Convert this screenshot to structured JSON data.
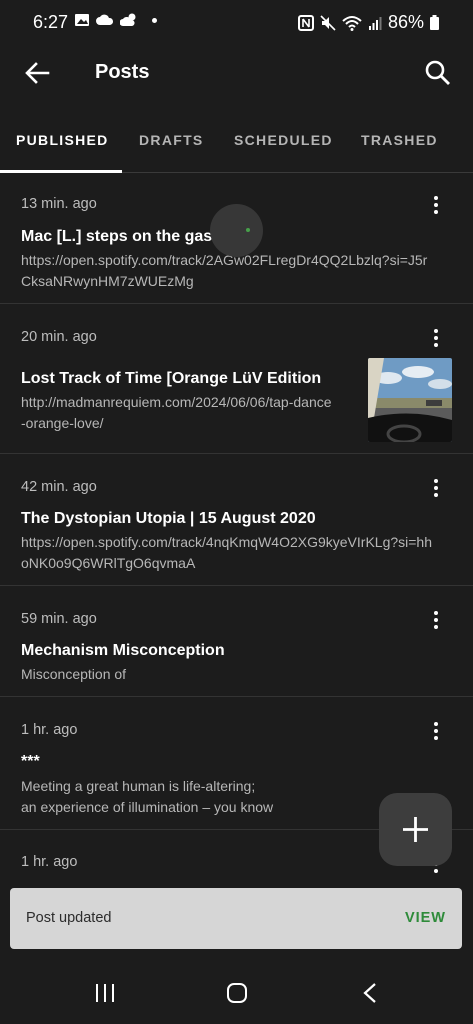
{
  "status_bar": {
    "time": "6:27",
    "battery": "86%"
  },
  "app_bar": {
    "title": "Posts"
  },
  "tabs": [
    {
      "label": "PUBLISHED"
    },
    {
      "label": "DRAFTS"
    },
    {
      "label": "SCHEDULED"
    },
    {
      "label": "TRASHED"
    }
  ],
  "posts": [
    {
      "time": "13 min. ago",
      "title": "Mac [L.] steps on the gas",
      "body": "https://open.spotify.com/track/2AGw02FLregDr4QQ2Lbzlq?si=J5rCksaNRwynHM7zWUEzMg"
    },
    {
      "time": "20 min. ago",
      "title": "Lost Track of Time [Orange LüV Edition",
      "body": "http://madmanrequiem.com/2024/06/06/tap-dance-orange-love/"
    },
    {
      "time": "42 min. ago",
      "title": "The Dystopian Utopia | 15 August 2020",
      "body": "https://open.spotify.com/track/4nqKmqW4O2XG9kyeVIrKLg?si=hhoNK0o9Q6WRlTgO6qvmaA"
    },
    {
      "time": "59 min. ago",
      "title": "Mechanism Misconception",
      "body": "Misconception of"
    },
    {
      "time": "1 hr. ago",
      "title": "***",
      "body_line1": "Meeting a great human is life-altering;",
      "body_line2": "an experience of illumination – you know"
    },
    {
      "time": "1 hr. ago"
    }
  ],
  "snackbar": {
    "message": "Post updated",
    "action": "VIEW"
  }
}
